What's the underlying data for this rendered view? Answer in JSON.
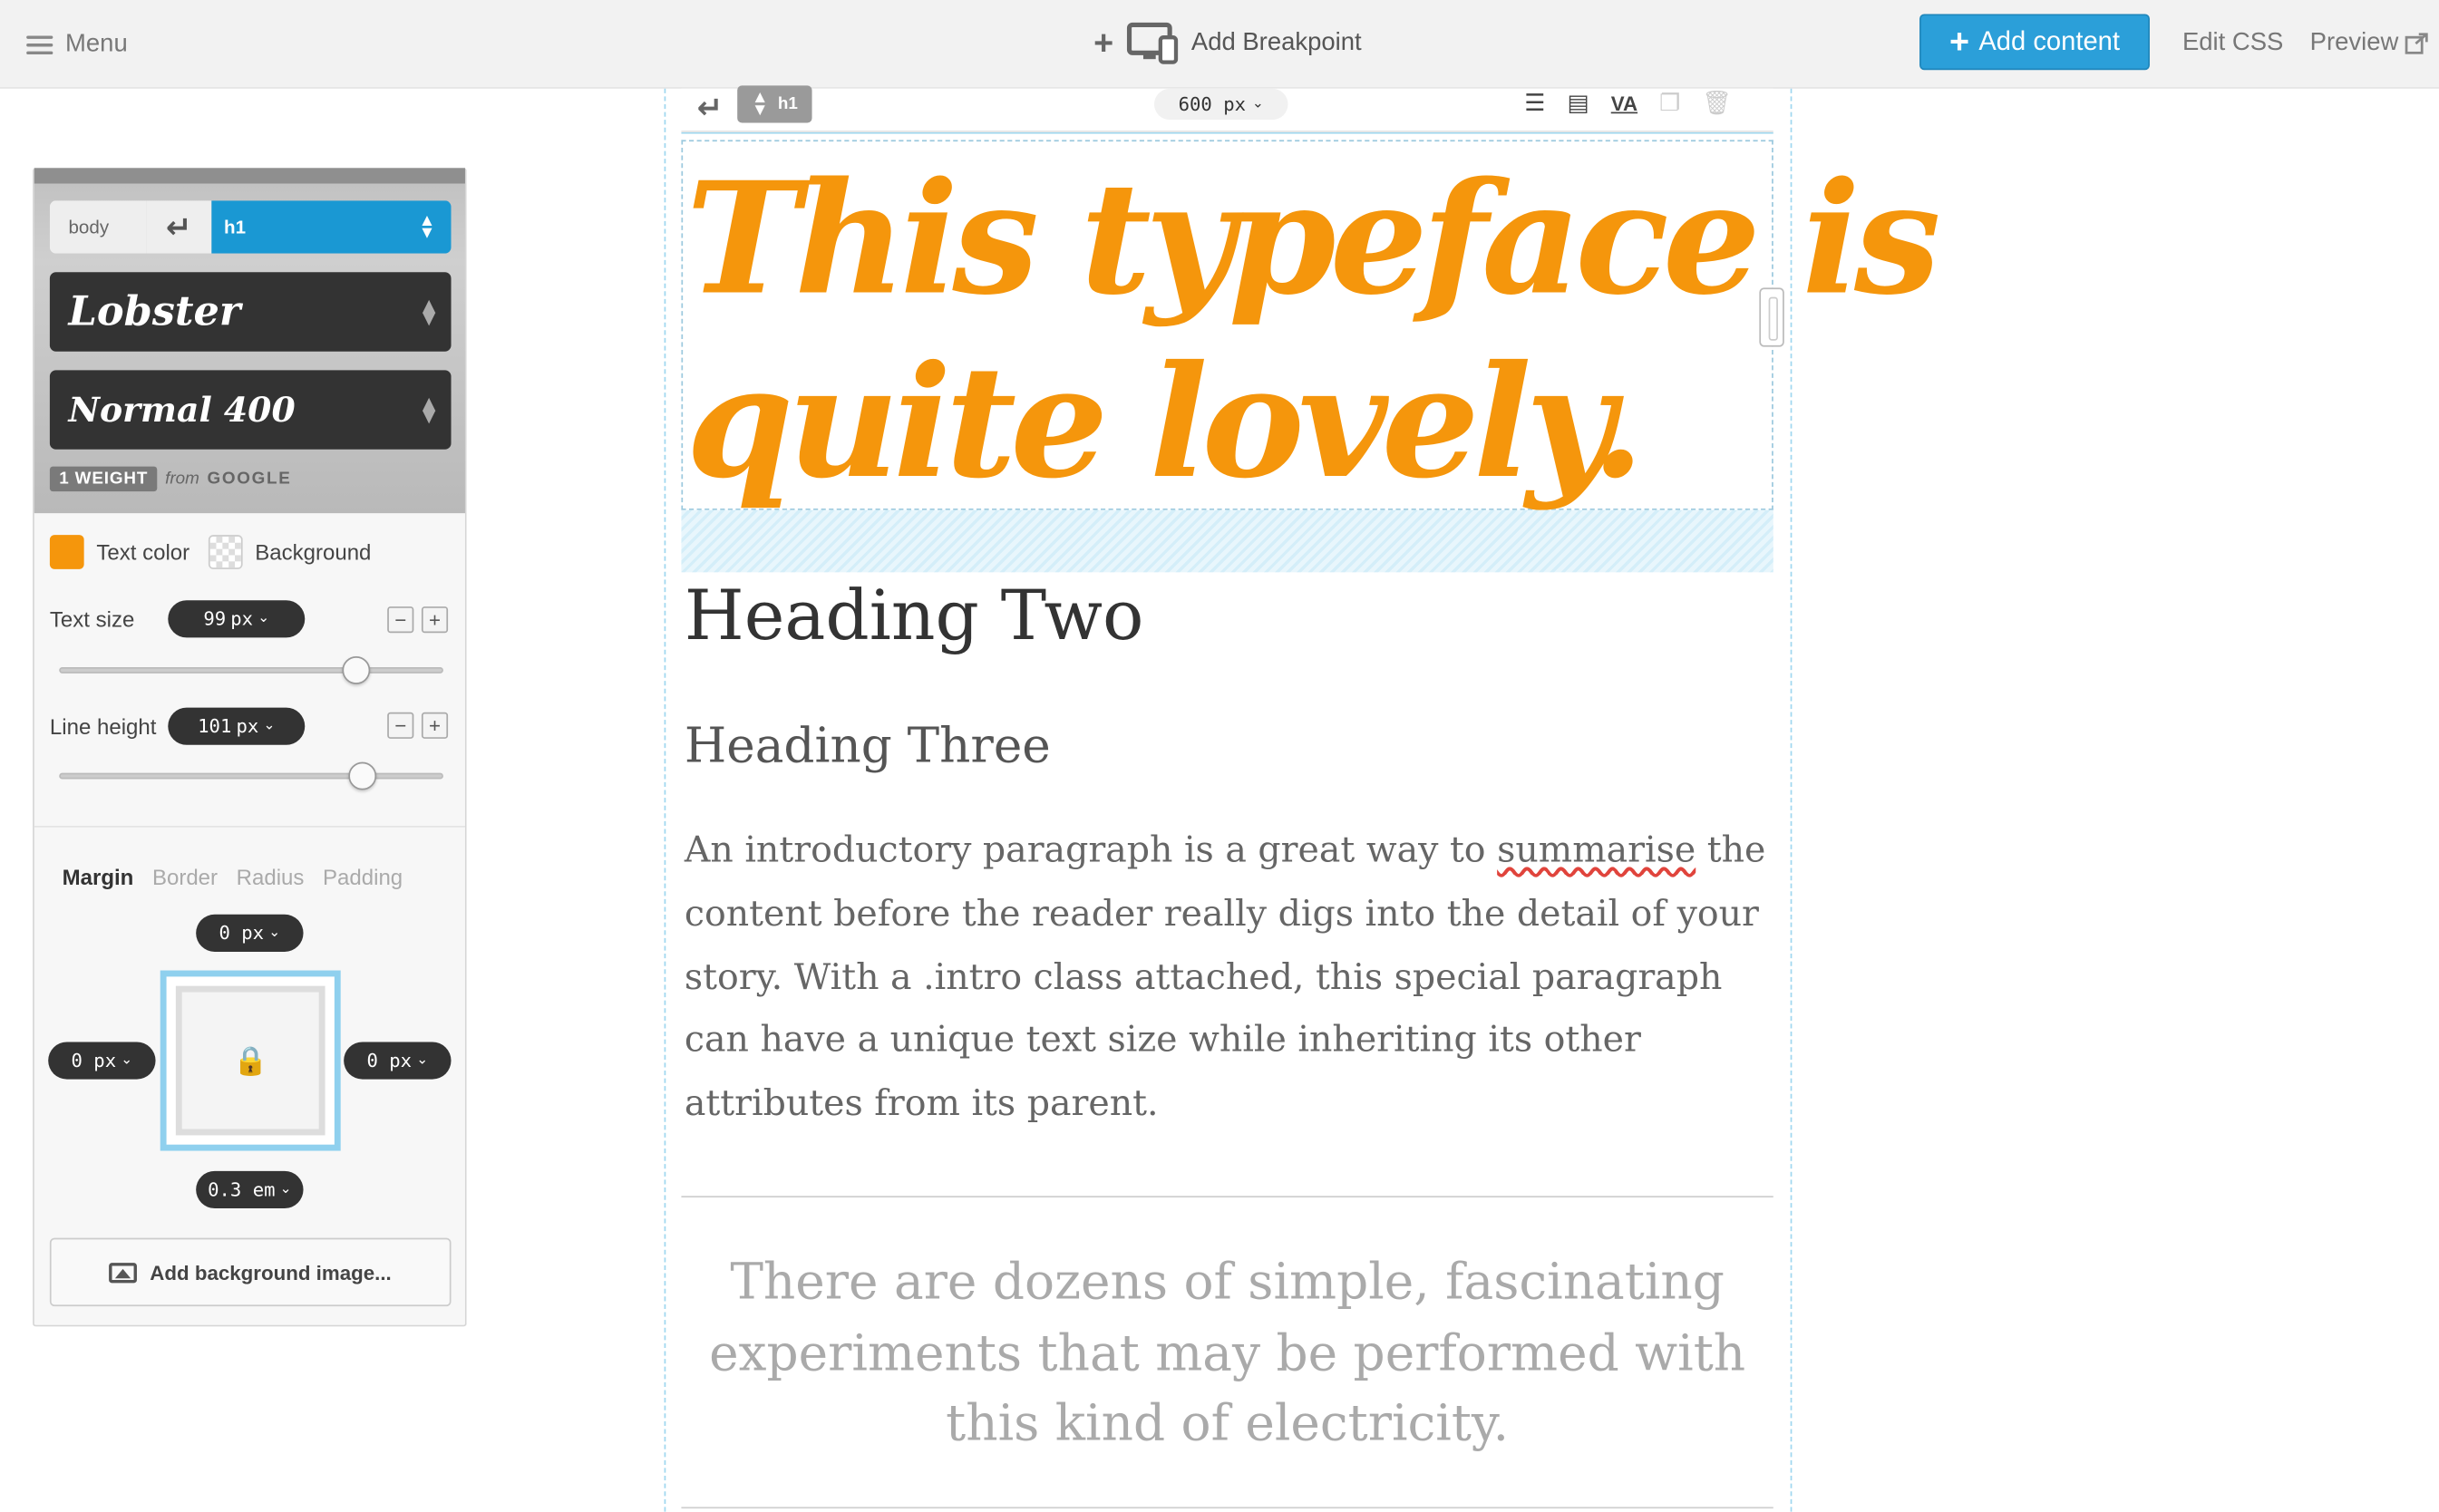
{
  "topbar": {
    "menu_label": "Menu",
    "breakpoint_label": "Add Breakpoint",
    "add_content_label": "Add content",
    "edit_css_label": "Edit CSS",
    "preview_label": "Preview"
  },
  "panel": {
    "breadcrumb": {
      "parent": "body",
      "current": "h1"
    },
    "font_family": "Lobster",
    "font_weight": "Normal 400",
    "weight_badge": "1 WEIGHT",
    "from_text": "from",
    "source": "GOOGLE",
    "text_color_label": "Text color",
    "text_color": "#f5960c",
    "background_label": "Background",
    "text_size_label": "Text size",
    "text_size_value": "99",
    "text_size_unit": "px",
    "text_size_slider": 0.79,
    "line_height_label": "Line height",
    "line_height_value": "101",
    "line_height_unit": "px",
    "line_height_slider": 0.81,
    "box_tabs": [
      "Margin",
      "Border",
      "Radius",
      "Padding"
    ],
    "active_tab": "Margin",
    "margin": {
      "top": "0 px",
      "left": "0 px",
      "right": "0 px",
      "bottom": "0.3 em"
    },
    "add_bg_label": "Add background image..."
  },
  "canvas": {
    "toolbar": {
      "tag": "h1",
      "width": "600 px",
      "kerning_label": "VA"
    },
    "h1": "This typeface is quite lovely.",
    "h2": "Heading Two",
    "h3": "Heading Three",
    "intro_before": "An introductory paragraph is a great way to ",
    "intro_misspelled": "summarise",
    "intro_after": " the content before the reader really digs into the detail of your story. With a .intro class attached, this special paragraph can have a unique text size while inheriting its other attributes from its parent.",
    "quote": "There are dozens of simple, fascinating experiments that may be performed with this kind of electricity."
  },
  "colors": {
    "accent": "#2b9fd9",
    "heading_orange": "#f5960c"
  }
}
